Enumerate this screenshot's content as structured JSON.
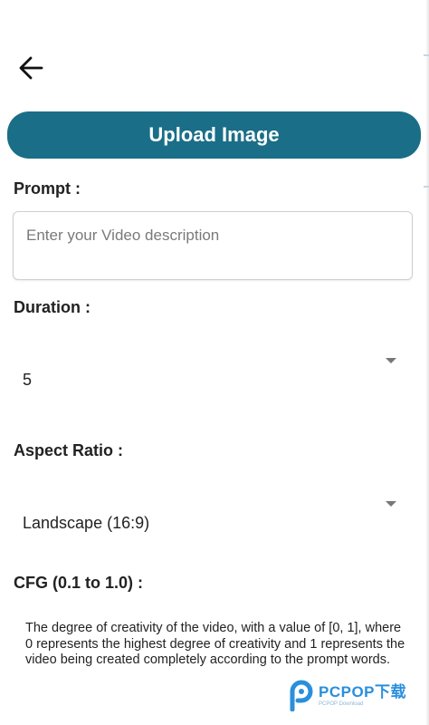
{
  "header": {
    "back_icon": "arrow-left-icon"
  },
  "upload": {
    "label": "Upload Image",
    "color": "#1a6e87"
  },
  "prompt": {
    "label": "Prompt :",
    "placeholder": "Enter your Video description",
    "value": ""
  },
  "duration": {
    "label": "Duration :",
    "selected": "5"
  },
  "aspect_ratio": {
    "label": "Aspect Ratio :",
    "selected": "Landscape (16:9)"
  },
  "cfg": {
    "label": "CFG (0.1 to 1.0) :",
    "description": "The degree of creativity of the video, with a value of [0, 1], where 0 represents the highest degree of creativity and 1 represents the video being created completely according to the prompt words."
  },
  "watermark": {
    "main": "PCPOP下载",
    "sub": "PCPOP Download"
  }
}
